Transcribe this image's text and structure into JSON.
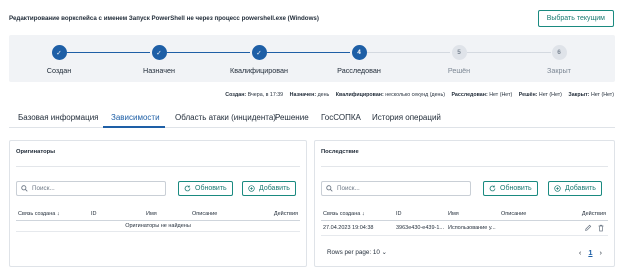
{
  "page": {
    "title": "Редактирование воркспейса с именем Запуск PowerShell не через процесс powershell.exe (Windows)",
    "pick_current_label": "Выбрать текущим"
  },
  "stepper": {
    "steps": [
      {
        "num": "✓",
        "label": "Создан",
        "state": "done"
      },
      {
        "num": "✓",
        "label": "Назначен",
        "state": "done"
      },
      {
        "num": "✓",
        "label": "Квалифицирован",
        "state": "done"
      },
      {
        "num": "4",
        "label": "Расследован",
        "state": "current"
      },
      {
        "num": "5",
        "label": "Решён",
        "state": "todo"
      },
      {
        "num": "6",
        "label": "Закрыт",
        "state": "todo"
      }
    ]
  },
  "meta": [
    {
      "key": "Создан:",
      "value": "Вчера, в 17:39"
    },
    {
      "key": "Назначен:",
      "value": "день"
    },
    {
      "key": "Квалифицирован:",
      "value": "несколько секунд  (день)"
    },
    {
      "key": "Расследован:",
      "value": "Нет  (Нет)"
    },
    {
      "key": "Решён:",
      "value": "Нет  (Нет)"
    },
    {
      "key": "Закрыт:",
      "value": "Нет  (Нет)"
    }
  ],
  "tabs": [
    {
      "label": "Базовая информация"
    },
    {
      "label": "Зависимости"
    },
    {
      "label": "Область атаки (инцидента)"
    },
    {
      "label": "Решение"
    },
    {
      "label": "ГосСОПКА"
    },
    {
      "label": "История операций"
    }
  ],
  "left_panel": {
    "title": "Оригинаторы",
    "search_placeholder": "Поиск...",
    "refresh_label": "Обновить",
    "add_label": "Добавить",
    "columns": {
      "created": "Связь создана",
      "id": "ID",
      "name": "Имя",
      "desc": "Описание",
      "actions": "Действия"
    },
    "empty_message": "Оригинаторы не найдены"
  },
  "right_panel": {
    "title": "Последствие",
    "search_placeholder": "Поиск...",
    "refresh_label": "Обновить",
    "add_label": "Добавить",
    "columns": {
      "created": "Связь создана",
      "id": "ID",
      "name": "Имя",
      "desc": "Описание",
      "actions": "Действия"
    },
    "rows": [
      {
        "created": "27.04.2023 19:04:38",
        "id": "3963e430-e439-1...",
        "name": "Использование у...",
        "desc": ""
      }
    ],
    "rows_per_page_label": "Rows per page: 10",
    "current_page": "1"
  },
  "colors": {
    "accent": "#1e5fa6",
    "teal": "#1a8a80",
    "stepper_bg": "#f1f3f6"
  }
}
